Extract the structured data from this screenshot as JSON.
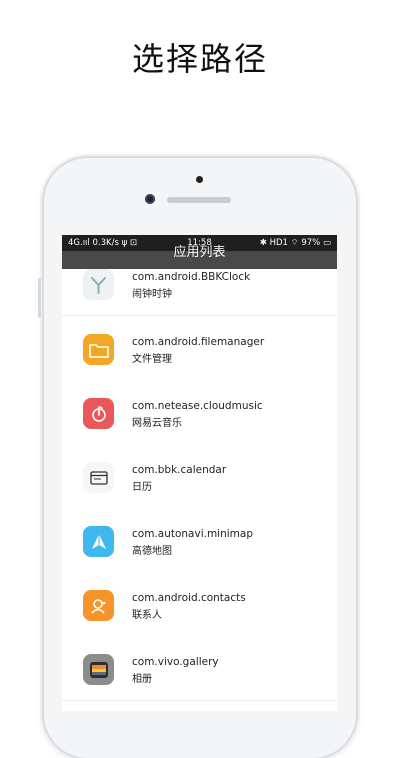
{
  "promo": {
    "title": "选择路径"
  },
  "status_bar": {
    "left": "4G.ııl 0.3K/s ψ ⊡",
    "time": "11:58",
    "right": "✱ HD1 ⌔ 97% ▭"
  },
  "header": {
    "title": "应用列表"
  },
  "apps": [
    {
      "package": "com.android.BBKClock",
      "name": "闹钟时钟",
      "icon": "clock-icon",
      "color": "#eef2f4"
    },
    {
      "package": "com.android.filemanager",
      "name": "文件管理",
      "icon": "folder-icon",
      "color": "#f2a825"
    },
    {
      "package": "com.netease.cloudmusic",
      "name": "网易云音乐",
      "icon": "music-icon",
      "color": "#e9585a"
    },
    {
      "package": "com.bbk.calendar",
      "name": "日历",
      "icon": "calendar-icon",
      "color": "#f6f6f8"
    },
    {
      "package": "com.autonavi.minimap",
      "name": "高德地图",
      "icon": "map-icon",
      "color": "#3fb8f0"
    },
    {
      "package": "com.android.contacts",
      "name": "联系人",
      "icon": "contacts-icon",
      "color": "#f6932a"
    },
    {
      "package": "com.vivo.gallery",
      "name": "相册",
      "icon": "gallery-icon",
      "color": "#9a9a9a"
    }
  ]
}
